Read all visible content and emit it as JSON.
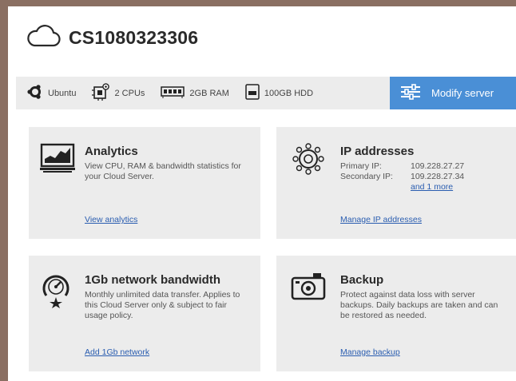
{
  "server": {
    "name": "CS1080323306",
    "icon": "cloud-icon"
  },
  "specs": [
    {
      "icon": "ubuntu-icon",
      "label": "Ubuntu"
    },
    {
      "icon": "cpu-icon",
      "label": "2 CPUs"
    },
    {
      "icon": "ram-icon",
      "label": "2GB RAM"
    },
    {
      "icon": "hdd-icon",
      "label": "100GB HDD"
    }
  ],
  "modify": {
    "label": "Modify server",
    "icon": "sliders-icon"
  },
  "cards": {
    "analytics": {
      "title": "Analytics",
      "desc": "View CPU, RAM & bandwidth statistics for your Cloud Server.",
      "link": "View analytics",
      "icon": "monitor-chart-icon"
    },
    "ip": {
      "title": "IP addresses",
      "primary_label": "Primary IP:",
      "primary_value": "109.228.27.27",
      "secondary_label": "Secondary IP:",
      "secondary_value": "109.228.27.34",
      "more": "and 1 more",
      "link": "Manage IP addresses",
      "icon": "network-cog-icon"
    },
    "bandwidth": {
      "title": "1Gb network bandwidth",
      "desc": "Monthly unlimited data transfer. Applies to this Cloud Server only & subject to fair usage policy.",
      "link": "Add 1Gb network",
      "icon": "speedometer-icon"
    },
    "backup": {
      "title": "Backup",
      "desc": "Protect against data loss with server backups. Daily backups are taken and can be restored as needed.",
      "link": "Manage backup",
      "icon": "camera-icon"
    }
  },
  "colors": {
    "accent": "#4a8fd6",
    "card_bg": "#ececec",
    "link": "#2a5db0"
  }
}
